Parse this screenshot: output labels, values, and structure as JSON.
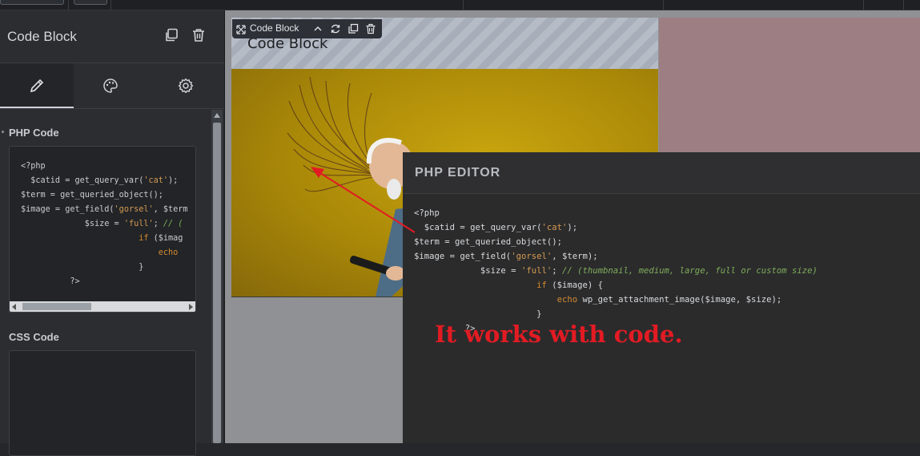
{
  "panel": {
    "title": "Code Block",
    "php_label": "PHP Code",
    "css_label": "CSS Code",
    "php_preview": "<?php\n  $catid = get_query_var('cat');\n$term = get_queried_object();\n$image = get_field('gorsel', $term\n             $size = 'full'; // (\n                        if ($imag\n                            echo\n                        }\n          ?>"
  },
  "canvas": {
    "element_title": "Code Block",
    "toolbar_label": "Code Block"
  },
  "editor": {
    "title": "PHP EDITOR",
    "code_lines": [
      "<?php",
      "  $catid = get_query_var('cat');",
      "$term = get_queried_object();",
      "$image = get_field('gorsel', $term);",
      "             $size = 'full'; // (thumbnail, medium, large, full or custom size)",
      "                        if ($image) {",
      "                            echo wp_get_attachment_image($image, $size);",
      "                        }",
      "          ?>"
    ]
  },
  "annotation": {
    "text": "It works with code.",
    "color": "#e21b23"
  },
  "icons": [
    "duplicate-icon",
    "trash-icon",
    "pencil-icon",
    "palette-icon",
    "gear-icon",
    "move-icon",
    "chevron-up-icon",
    "refresh-icon",
    "copy-icon",
    "delete-icon"
  ]
}
